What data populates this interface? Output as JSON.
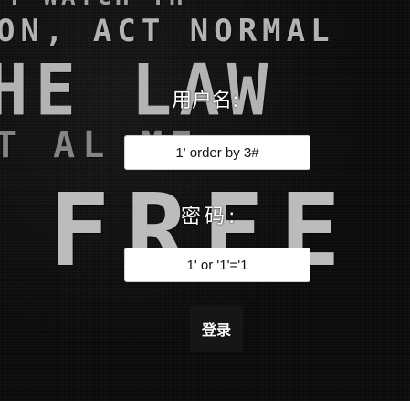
{
  "background": {
    "lines": [
      "T WATCH TH",
      "ON, ACT NORMAL",
      "HE LAW",
      "T AL   ME:",
      "FREE"
    ]
  },
  "login_form": {
    "username_label": "用户名:",
    "username_value": "1' order by 3#",
    "password_label": "密码:",
    "password_value": "1' or '1'='1",
    "submit_label": "登录"
  },
  "colors": {
    "page_background": "#0a0a0a",
    "label_text": "#ffffff",
    "input_background": "#ffffff",
    "button_background": "#161616"
  }
}
